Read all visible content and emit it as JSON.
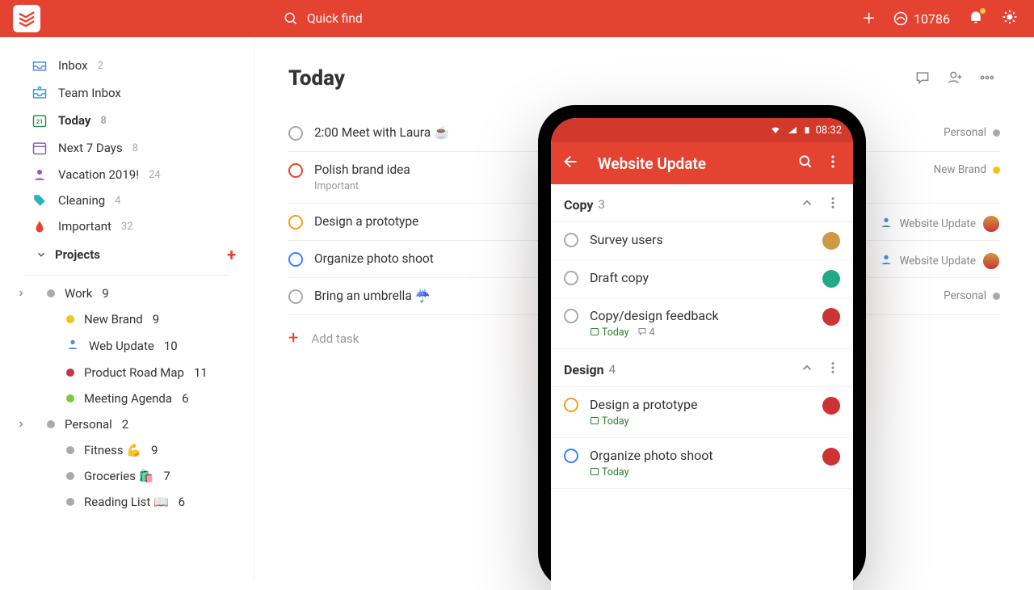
{
  "topbar": {
    "search_placeholder": "Quick find",
    "karma": "10786"
  },
  "sidebar": {
    "inbox": {
      "label": "Inbox",
      "count": "2"
    },
    "team_inbox": {
      "label": "Team Inbox"
    },
    "today": {
      "label": "Today",
      "count": "8"
    },
    "next7": {
      "label": "Next 7 Days",
      "count": "8"
    },
    "vacation": {
      "label": "Vacation 2019!",
      "count": "24"
    },
    "cleaning": {
      "label": "Cleaning",
      "count": "4"
    },
    "important": {
      "label": "Important",
      "count": "32"
    },
    "projects_header": "Projects",
    "work": {
      "label": "Work",
      "count": "9"
    },
    "work_children": [
      {
        "label": "New Brand",
        "count": "9",
        "color": "#f0c419"
      },
      {
        "label": "Web Update",
        "count": "10",
        "color": "#4a90e2",
        "person": true
      },
      {
        "label": "Product Road Map",
        "count": "11",
        "color": "#c8324c"
      },
      {
        "label": "Meeting Agenda",
        "count": "6",
        "color": "#7ac943"
      }
    ],
    "personal": {
      "label": "Personal",
      "count": "2"
    },
    "personal_children": [
      {
        "label": "Fitness 💪",
        "count": "9",
        "color": "#aaa"
      },
      {
        "label": "Groceries 🛍️",
        "count": "7",
        "color": "#aaa"
      },
      {
        "label": "Reading List 📖",
        "count": "6",
        "color": "#aaa"
      }
    ]
  },
  "main": {
    "title": "Today",
    "add_task_label": "Add task",
    "tasks": [
      {
        "title": "2:00 Meet with Laura ☕",
        "priority": "#aaa",
        "project": "Personal",
        "dot": "#aaa"
      },
      {
        "title": "Polish brand idea",
        "sub": "Important",
        "priority": "#e44332",
        "project": "New Brand",
        "dot": "#f0c419"
      },
      {
        "title": "Design a prototype",
        "priority": "#f0a119",
        "project": "Website Update",
        "assignee": true,
        "avatar": true
      },
      {
        "title": "Organize photo shoot",
        "priority": "#3b83f6",
        "project": "Website Update",
        "assignee": true,
        "avatar": true
      },
      {
        "title": "Bring an umbrella ☔",
        "priority": "#aaa",
        "project": "Personal",
        "dot": "#aaa"
      }
    ]
  },
  "phone": {
    "time": "08:32",
    "title": "Website Update",
    "sections": [
      {
        "name": "Copy",
        "count": "3",
        "tasks": [
          {
            "name": "Survey users",
            "priority": "#aaa",
            "avatar": "#c94"
          },
          {
            "name": "Draft copy",
            "priority": "#aaa",
            "avatar": "#2a8"
          },
          {
            "name": "Copy/design feedback",
            "priority": "#aaa",
            "avatar": "#c33",
            "due": "Today",
            "comments": "4"
          }
        ]
      },
      {
        "name": "Design",
        "count": "4",
        "tasks": [
          {
            "name": "Design a prototype",
            "priority": "#f0a119",
            "avatar": "#c33",
            "due": "Today"
          },
          {
            "name": "Organize photo shoot",
            "priority": "#3b83f6",
            "avatar": "#c33",
            "due": "Today"
          }
        ]
      }
    ]
  }
}
